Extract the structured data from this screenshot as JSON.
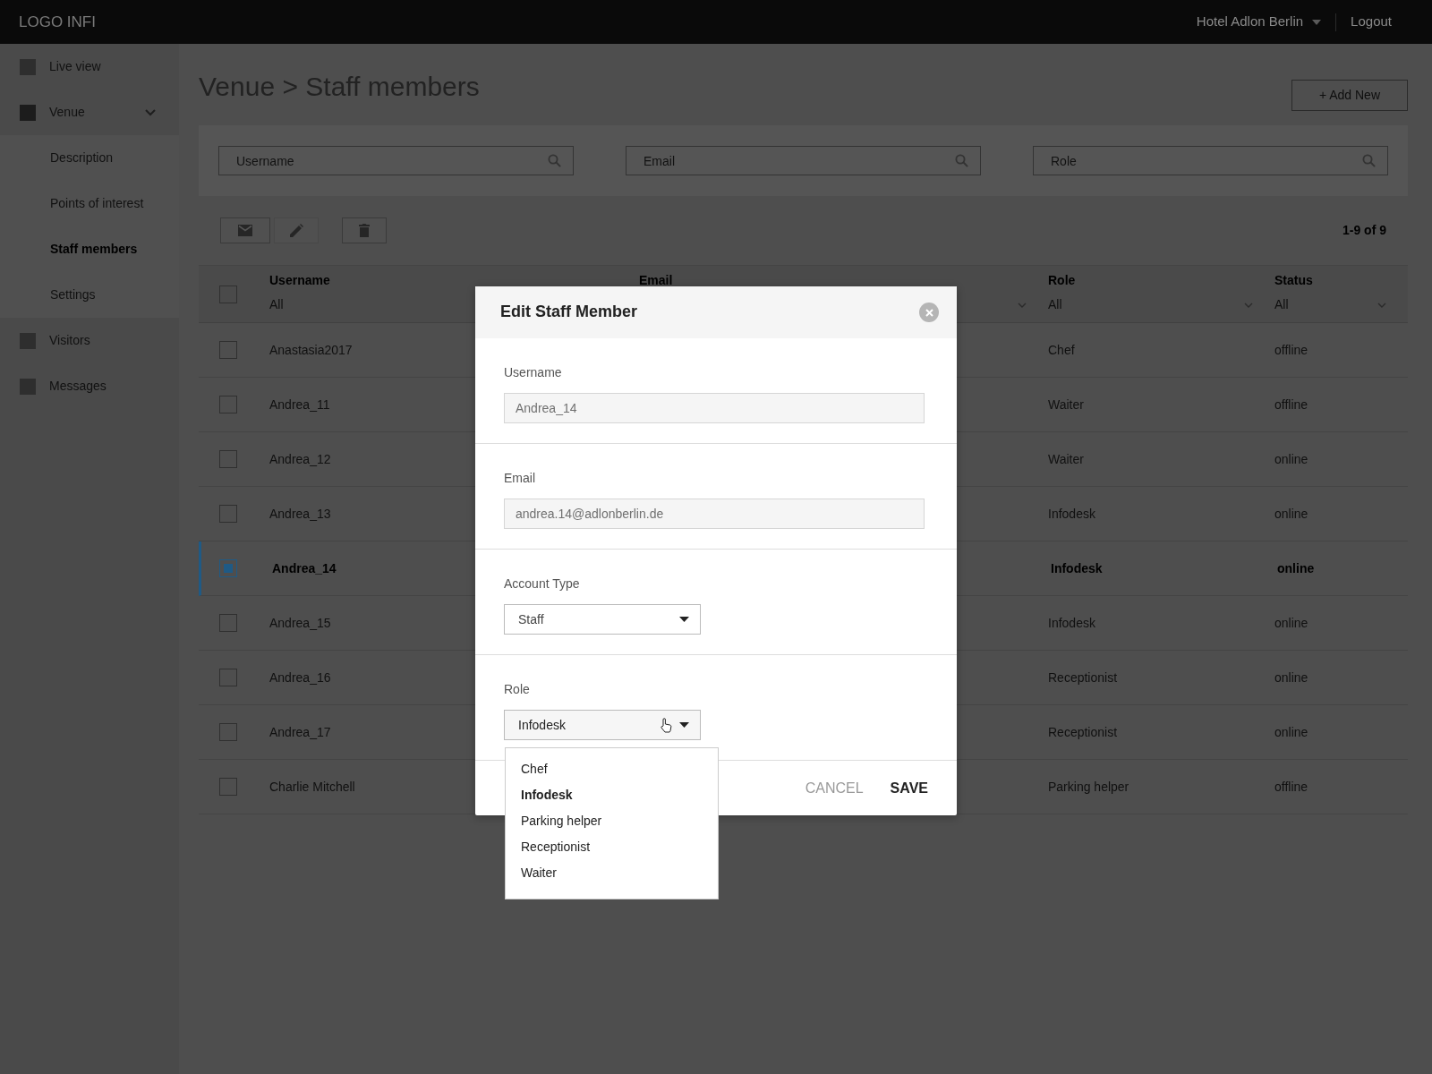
{
  "topbar": {
    "logo": "LOGO INFI",
    "venue_menu": "Hotel Adlon Berlin",
    "logout": "Logout"
  },
  "sidebar": {
    "items": [
      {
        "label": "Live view",
        "selected": false
      },
      {
        "label": "Venue",
        "selected": false,
        "expanded": true,
        "children": [
          {
            "label": "Description",
            "selected": false
          },
          {
            "label": "Points of interest",
            "selected": false
          },
          {
            "label": "Staff members",
            "selected": true
          },
          {
            "label": "Settings",
            "selected": false
          }
        ]
      },
      {
        "label": "Visitors",
        "selected": false
      },
      {
        "label": "Messages",
        "selected": false
      }
    ]
  },
  "page": {
    "title": "Venue > Staff members",
    "add_button": "+ Add New"
  },
  "filters": [
    {
      "placeholder": "Username"
    },
    {
      "placeholder": "Email"
    },
    {
      "placeholder": "Role"
    }
  ],
  "pagination": "1-9 of 9",
  "table": {
    "select_all_checked": false,
    "columns": [
      {
        "label": "Username",
        "filter": "All"
      },
      {
        "label": "Email"
      },
      {
        "label": "Role",
        "filter": "All"
      },
      {
        "label": "Status",
        "filter": "All"
      }
    ],
    "rows": [
      {
        "username": "Anastasia2017",
        "role": "Chef",
        "status": "offline",
        "selected": false
      },
      {
        "username": "Andrea_11",
        "role": "Waiter",
        "status": "offline",
        "selected": false
      },
      {
        "username": "Andrea_12",
        "role": "Waiter",
        "status": "online",
        "selected": false
      },
      {
        "username": "Andrea_13",
        "role": "Infodesk",
        "status": "online",
        "selected": false
      },
      {
        "username": "Andrea_14",
        "role": "Infodesk",
        "status": "online",
        "selected": true
      },
      {
        "username": "Andrea_15",
        "role": "Infodesk",
        "status": "online",
        "selected": false
      },
      {
        "username": "Andrea_16",
        "role": "Receptionist",
        "status": "online",
        "selected": false
      },
      {
        "username": "Andrea_17",
        "role": "Receptionist",
        "status": "online",
        "selected": false
      },
      {
        "username": "Charlie Mitchell",
        "role": "Parking helper",
        "status": "offline",
        "selected": false
      }
    ]
  },
  "modal": {
    "title": "Edit Staff Member",
    "fields": [
      {
        "kind": "text",
        "label": "Username",
        "value": "Andrea_14",
        "disabled": true
      },
      {
        "kind": "text",
        "label": "Email",
        "value": "andrea.14@adlonberlin.de",
        "disabled": true
      },
      {
        "kind": "select",
        "label": "Account Type",
        "value": "Staff",
        "expanded": false
      },
      {
        "kind": "select",
        "label": "Role",
        "value": "Infodesk",
        "expanded": true,
        "options": [
          {
            "label": "Chef",
            "selected": false
          },
          {
            "label": "Infodesk",
            "selected": true
          },
          {
            "label": "Parking helper",
            "selected": false
          },
          {
            "label": "Receptionist",
            "selected": false
          },
          {
            "label": "Waiter",
            "selected": false
          }
        ]
      }
    ],
    "cancel": "CANCEL",
    "save": "SAVE"
  }
}
